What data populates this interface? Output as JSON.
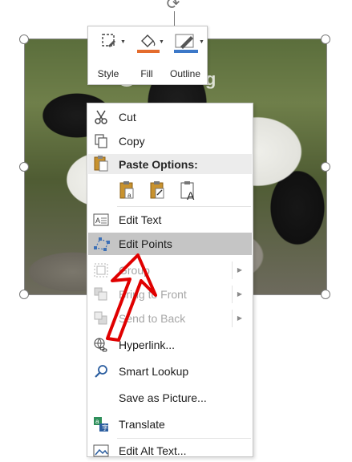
{
  "mini_toolbar": {
    "style_label": "Style",
    "fill_label": "Fill",
    "outline_label": "Outline",
    "fill_color": "#e46c2d",
    "outline_color": "#3c78c8"
  },
  "watermark": "uantrimang",
  "menu": {
    "cut": "Cut",
    "copy": "Copy",
    "paste_options": "Paste Options:",
    "edit_text": "Edit Text",
    "edit_points": "Edit Points",
    "group": "Group",
    "bring_to_front": "Bring to Front",
    "send_to_back": "Send to Back",
    "hyperlink": "Hyperlink...",
    "smart_lookup": "Smart Lookup",
    "save_as_picture": "Save as Picture...",
    "translate": "Translate",
    "edit_alt_text": "Edit Alt Text..."
  },
  "colors": {
    "highlight": "#c5c5c5",
    "annotation_arrow": "#e00000",
    "paste_icon": "#c8922e"
  }
}
